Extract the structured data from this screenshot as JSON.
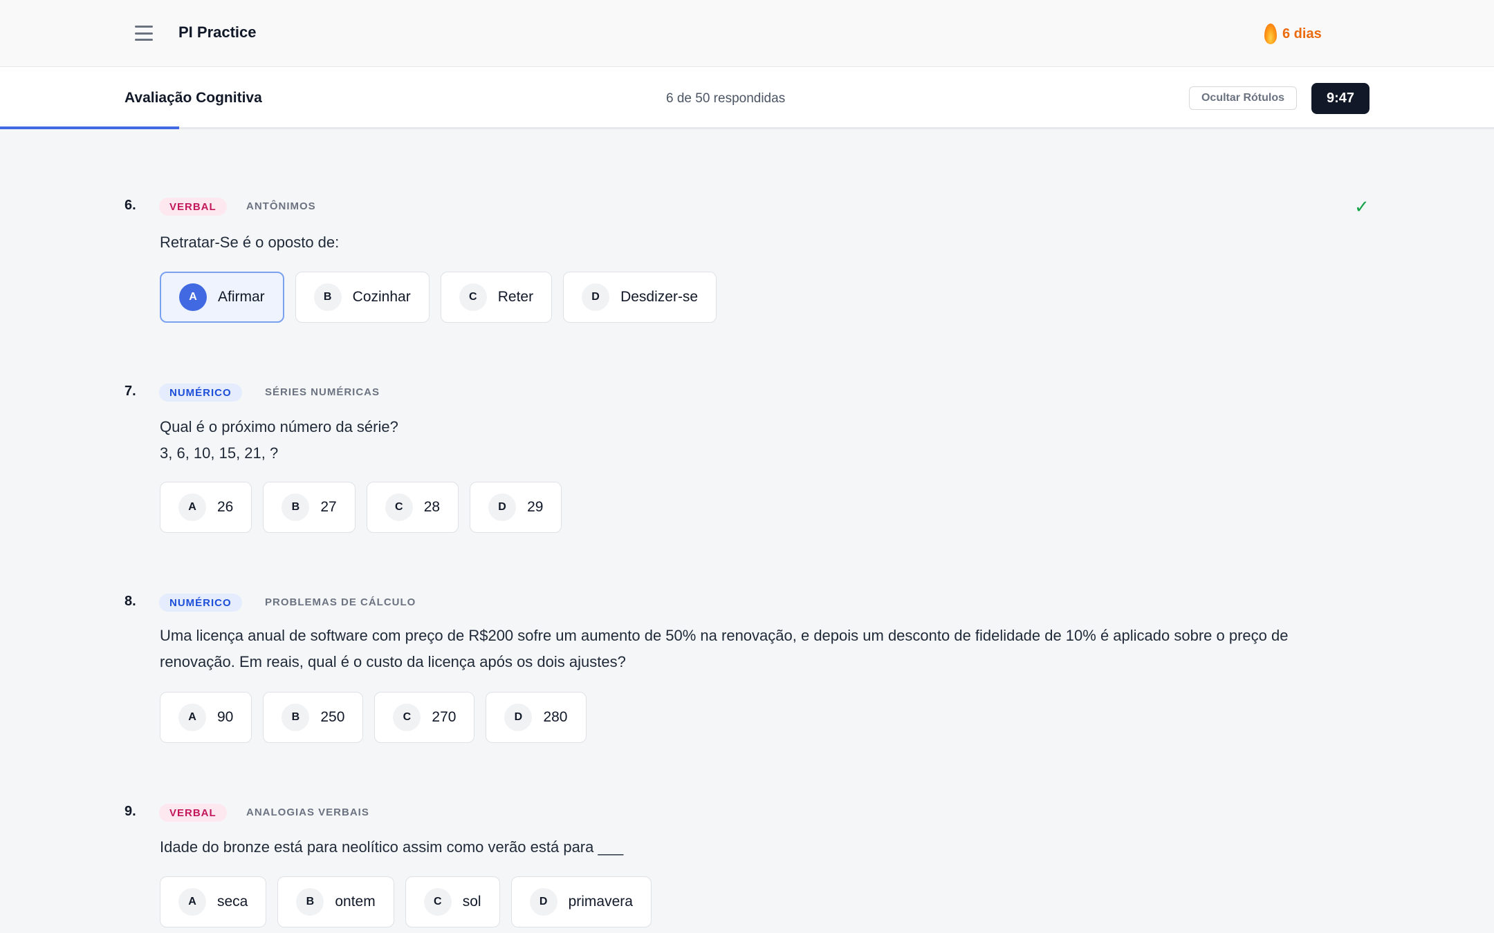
{
  "app": {
    "title": "PI Practice",
    "streak": "6 dias"
  },
  "quiz": {
    "title": "Avaliação Cognitiva",
    "answered": "6 de 50 respondidas",
    "hide_labels": "Ocultar Rótulos",
    "timer": "9:47",
    "progress_fraction": 0.12
  },
  "questions": [
    {
      "number": "6.",
      "tag": "VERBAL",
      "subtype": "ANTÔNIMOS",
      "text": "Retratar-Se é o oposto de:",
      "answered": true,
      "options": [
        {
          "letter": "A",
          "label": "Afirmar",
          "selected": true
        },
        {
          "letter": "B",
          "label": "Cozinhar"
        },
        {
          "letter": "C",
          "label": "Reter"
        },
        {
          "letter": "D",
          "label": "Desdizer-se"
        }
      ]
    },
    {
      "number": "7.",
      "tag": "NUMÉRICO",
      "subtype": "SÉRIES NUMÉRICAS",
      "text": "Qual é o próximo número da série?",
      "text2": "3, 6, 10, 15, 21, ?",
      "options": [
        {
          "letter": "A",
          "label": "26"
        },
        {
          "letter": "B",
          "label": "27"
        },
        {
          "letter": "C",
          "label": "28"
        },
        {
          "letter": "D",
          "label": "29"
        }
      ]
    },
    {
      "number": "8.",
      "tag": "NUMÉRICO",
      "subtype": "PROBLEMAS DE CÁLCULO",
      "text": "Uma licença anual de software com preço de R$200 sofre um aumento de 50% na renovação, e depois um desconto de fidelidade de 10% é aplicado sobre o preço de",
      "text2": "renovação. Em reais, qual é o custo da licença após os dois ajustes?",
      "options": [
        {
          "letter": "A",
          "label": "90"
        },
        {
          "letter": "B",
          "label": "250"
        },
        {
          "letter": "C",
          "label": "270"
        },
        {
          "letter": "D",
          "label": "280"
        }
      ]
    },
    {
      "number": "9.",
      "tag": "VERBAL",
      "subtype": "ANALOGIAS VERBAIS",
      "text": "Idade do bronze está para neolítico assim como verão está para ___",
      "options": [
        {
          "letter": "A",
          "label": "seca"
        },
        {
          "letter": "B",
          "label": "ontem"
        },
        {
          "letter": "C",
          "label": "sol"
        },
        {
          "letter": "D",
          "label": "primavera"
        }
      ]
    }
  ]
}
